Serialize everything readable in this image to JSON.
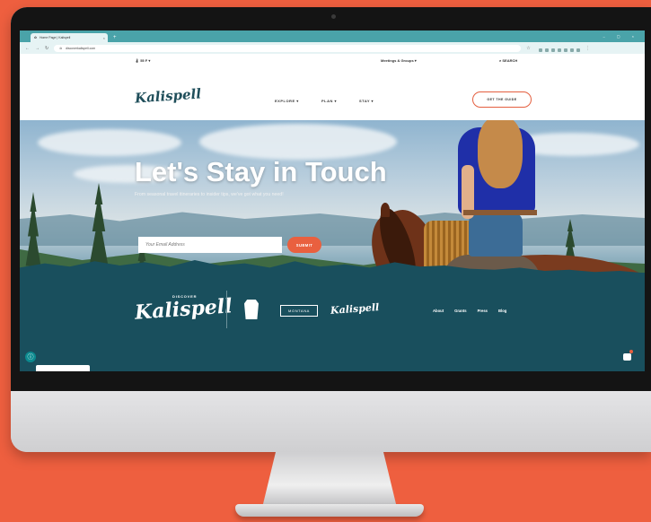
{
  "browser": {
    "tab_title": "Home Page | Kalispell",
    "new_tab": "+",
    "url": "discoverkalispell.com"
  },
  "topbar": {
    "weather": "55 F",
    "meetings": "Meetings & Groups",
    "search": "SEARCH"
  },
  "nav": {
    "logo": "Kalispell",
    "items": [
      "EXPLORE",
      "PLAN",
      "STAY"
    ],
    "cta": "GET THE GUIDE"
  },
  "hero": {
    "title": "Let's Stay in Touch",
    "subtitle": "From seasonal travel itineraries to insider tips, we've got what you need!",
    "email_placeholder": "Your Email Address",
    "submit": "SUBMIT"
  },
  "footer": {
    "discover": "DISCOVER",
    "logo": "Kalispell",
    "montana": "MONTANA",
    "logo2": "Kalispell",
    "links": [
      "About",
      "Grants",
      "Press",
      "Blog"
    ]
  },
  "colors": {
    "background": "#ee5f3f",
    "accent": "#e9603f",
    "footer": "#194f5d",
    "browser": "#4aa3a9"
  }
}
